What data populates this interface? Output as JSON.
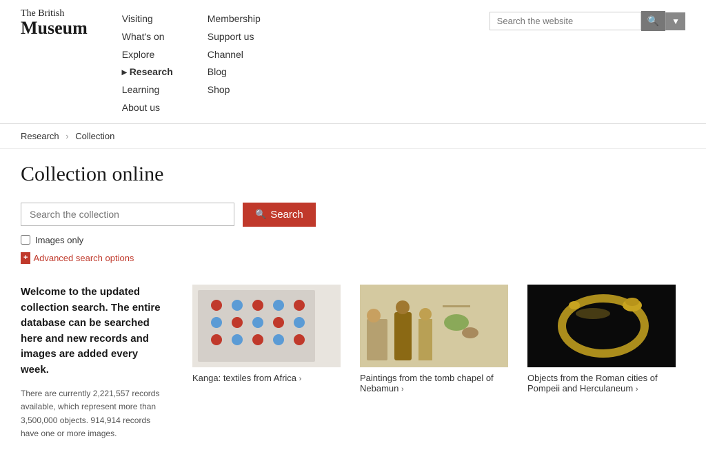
{
  "logo": {
    "line1": "The British",
    "line2": "Museum"
  },
  "nav": {
    "col1": [
      {
        "label": "Visiting",
        "active": false
      },
      {
        "label": "What's on",
        "active": false
      },
      {
        "label": "Explore",
        "active": false
      },
      {
        "label": "Research",
        "active": true
      },
      {
        "label": "Learning",
        "active": false
      },
      {
        "label": "About us",
        "active": false
      }
    ],
    "col2": [
      {
        "label": "Membership",
        "active": false
      },
      {
        "label": "Support us",
        "active": false
      },
      {
        "label": "Channel",
        "active": false
      },
      {
        "label": "Blog",
        "active": false
      },
      {
        "label": "Shop",
        "active": false
      }
    ]
  },
  "header": {
    "search_placeholder": "Search the website",
    "search_button_label": "🔍",
    "dropdown_label": "▾"
  },
  "breadcrumb": {
    "items": [
      {
        "label": "Research",
        "link": true
      },
      {
        "label": "Collection",
        "link": false
      }
    ]
  },
  "page": {
    "title": "Collection online",
    "collection_search_placeholder": "Search the collection",
    "search_button_label": "Search",
    "images_only_label": "Images only",
    "advanced_search_label": "Advanced search options",
    "advanced_plus": "+"
  },
  "welcome": {
    "heading": "Welcome to the updated collection search. The entire database can be searched here and new records and images are added every week.",
    "stats": "There are currently 2,221,557 records available, which represent more than 3,500,000 objects. 914,914 records have one or more images."
  },
  "cards": [
    {
      "id": "kanga",
      "title": "Kanga: textiles from Africa",
      "has_arrow": true
    },
    {
      "id": "nebamun",
      "title": "Paintings from the tomb chapel of Nebamun",
      "has_arrow": true
    },
    {
      "id": "pompeii",
      "title": "Objects from the Roman cities of Pompeii and Herculaneum",
      "has_arrow": true
    }
  ]
}
